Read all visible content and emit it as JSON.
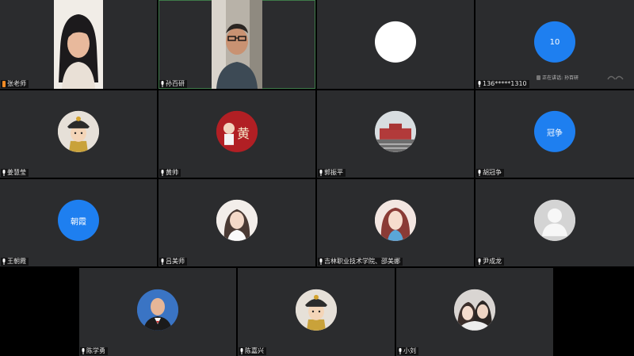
{
  "participants": [
    {
      "name": "张老师",
      "kind": "video",
      "mic": "muted"
    },
    {
      "name": "孙百研",
      "kind": "video",
      "mic": "on"
    },
    {
      "name": "",
      "kind": "avatar-white",
      "mic": "none"
    },
    {
      "name": "136*****1310",
      "kind": "avatar-blue",
      "avatar_text": "10",
      "mic": "on"
    },
    {
      "name": "姜慧莹",
      "kind": "cartoon-emperor",
      "mic": "on"
    },
    {
      "name": "黄帅",
      "kind": "cartoon-red",
      "avatar_text": "黄",
      "mic": "on"
    },
    {
      "name": "郭振平",
      "kind": "photo-building",
      "mic": "on"
    },
    {
      "name": "胡冠争",
      "kind": "avatar-blue",
      "avatar_text": "冠争",
      "mic": "on"
    },
    {
      "name": "王朝霞",
      "kind": "avatar-blue",
      "avatar_text": "朝霞",
      "mic": "on"
    },
    {
      "name": "吕美师",
      "kind": "photo-girl",
      "mic": "on"
    },
    {
      "name": "吉林职业技术学院、邵美娜",
      "kind": "photo-woman",
      "mic": "on"
    },
    {
      "name": "尹成龙",
      "kind": "avatar-default",
      "mic": "on"
    },
    {
      "name": "陈学勇",
      "kind": "photo-man",
      "mic": "on"
    },
    {
      "name": "陈嘉兴",
      "kind": "cartoon-emperor",
      "mic": "on"
    },
    {
      "name": "小刘",
      "kind": "photo-couple",
      "mic": "on"
    }
  ],
  "speaking_indicator": "正在讲话: 孙百研",
  "colors": {
    "tile_bg": "#2b2c2e",
    "stage_bg": "#000000",
    "avatar_blue": "#1e7ff0",
    "active_border": "#3f7a4a",
    "muted_mic": "#f08a24"
  }
}
